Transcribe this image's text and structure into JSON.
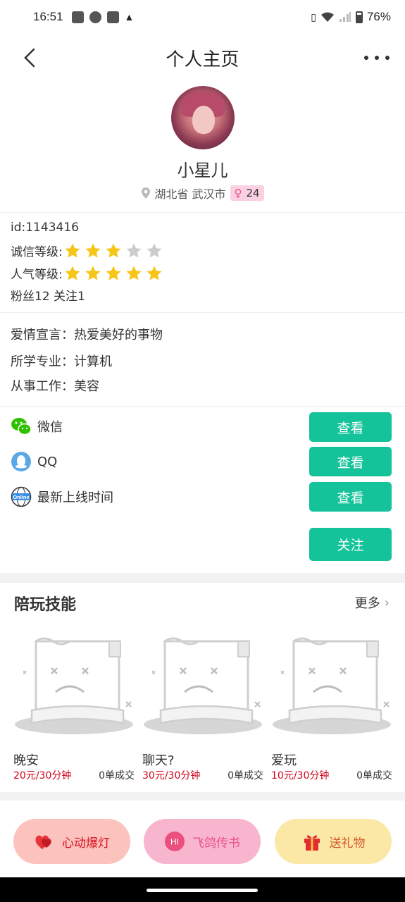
{
  "status_bar": {
    "time": "16:51",
    "battery": "76%"
  },
  "header": {
    "title": "个人主页"
  },
  "profile": {
    "nickname": "小星儿",
    "location": "湖北省 武汉市",
    "gender_symbol": "♀",
    "age": "24"
  },
  "info": {
    "id": "id:1143416",
    "credit_label": "诚信等级:",
    "credit_rating": 3,
    "popularity_label": "人气等级:",
    "popularity_rating": 5,
    "stars_max": 5,
    "fans_follow": "粉丝12  关注1"
  },
  "details": {
    "love": "爱情宣言：热爱美好的事物",
    "major": "所学专业：计算机",
    "job": "从事工作：美容"
  },
  "contacts": {
    "wechat": "微信",
    "qq": "QQ",
    "online": "最新上线时间",
    "online_badge": "Online",
    "view_label": "查看",
    "follow_label": "关注"
  },
  "skills": {
    "title": "陪玩技能",
    "more": "更多",
    "items": [
      {
        "name": "晚安",
        "price": "20元/30分钟",
        "orders": "0单成交"
      },
      {
        "name": "聊天?",
        "price": "30元/30分钟",
        "orders": "0单成交"
      },
      {
        "name": "爱玩",
        "price": "10元/30分钟",
        "orders": "0单成交"
      }
    ]
  },
  "bottom": {
    "heart": "心动爆灯",
    "pigeon": "飞鸽传书",
    "pigeon_badge": "HI",
    "gift": "送礼物"
  },
  "colors": {
    "accent": "#15c39a",
    "star_on": "#f5c518",
    "star_off": "#cccccc",
    "price": "#d0021b"
  }
}
